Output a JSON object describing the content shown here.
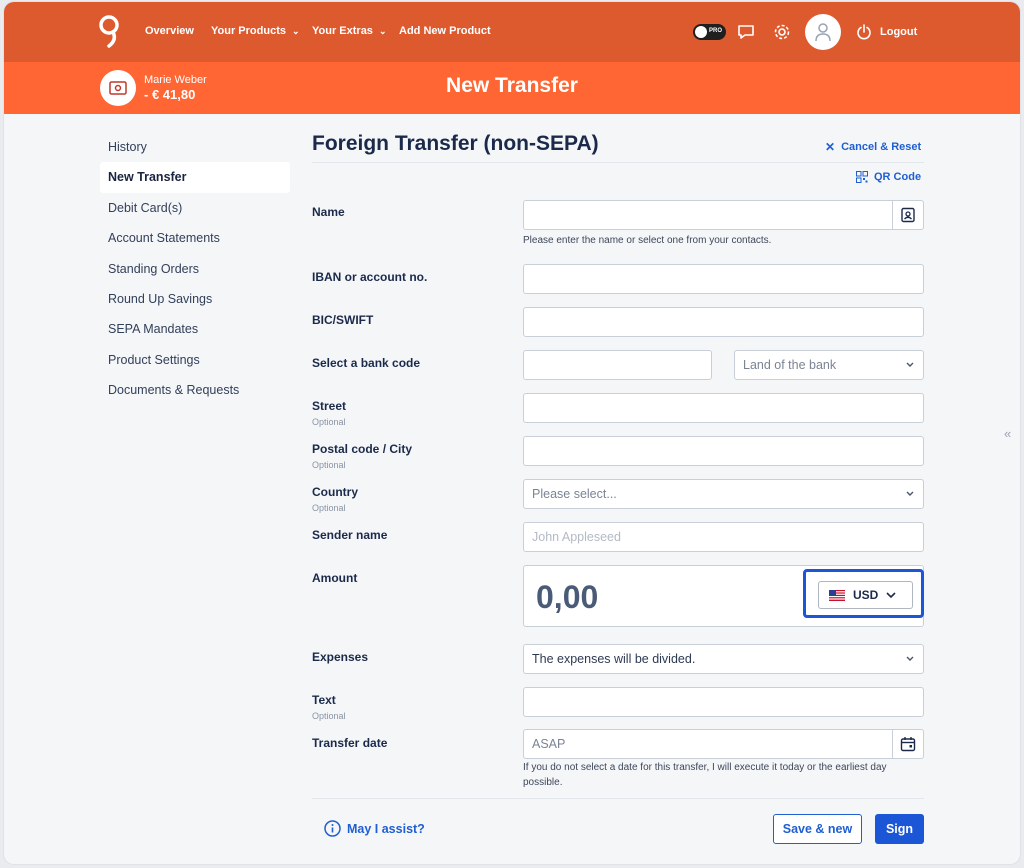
{
  "nav": {
    "items": [
      "Overview",
      "Your Products",
      "Your Extras",
      "Add New Product"
    ],
    "pro_label": "PRO",
    "logout": "Logout"
  },
  "account": {
    "name": "Marie Weber",
    "balance": "- € 41,80"
  },
  "header": {
    "title": "New Transfer"
  },
  "sidebar": {
    "items": [
      "History",
      "New Transfer",
      "Debit Card(s)",
      "Account Statements",
      "Standing Orders",
      "Round Up Savings",
      "SEPA Mandates",
      "Product Settings",
      "Documents & Requests"
    ],
    "active": "New Transfer"
  },
  "form": {
    "title": "Foreign Transfer (non-SEPA)",
    "cancel": "Cancel & Reset",
    "qr": "QR Code",
    "labels": {
      "name": "Name",
      "iban": "IBAN or account no.",
      "bic": "BIC/SWIFT",
      "bank_code": "Select a bank code",
      "street": "Street",
      "postal": "Postal code / City",
      "country": "Country",
      "sender": "Sender name",
      "amount": "Amount",
      "expenses": "Expenses",
      "text": "Text",
      "date": "Transfer date"
    },
    "optional": "Optional",
    "name_help": "Please enter the name or select one from your contacts.",
    "bank_land": "Land of the bank",
    "country_placeholder": "Please select...",
    "sender_placeholder": "John Appleseed",
    "amount_value": "0,00",
    "currency": "USD",
    "expenses_value": "The expenses will be divided.",
    "date_placeholder": "ASAP",
    "date_help": "If you do not select a date for this transfer, I will execute it today or the earliest day possible."
  },
  "footer": {
    "assist": "May I assist?",
    "save_new": "Save & new",
    "sign": "Sign"
  },
  "colors": {
    "topbar": "#dd5a2f",
    "subbar": "#ff6633",
    "accent": "#1a56d6"
  }
}
